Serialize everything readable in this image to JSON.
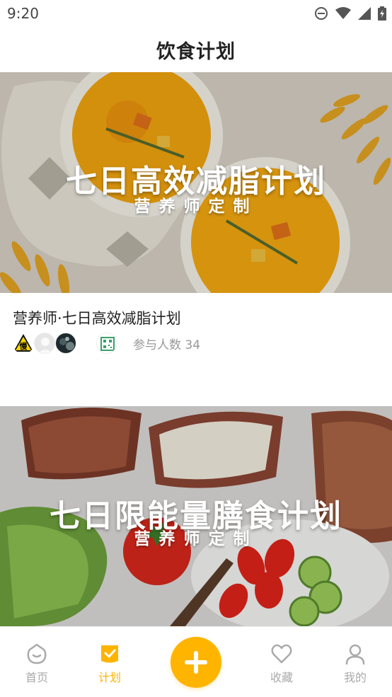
{
  "status_bar": {
    "time": "9:20",
    "icons": [
      "do-not-disturb-icon",
      "wifi-icon",
      "signal-icon",
      "battery-icon"
    ]
  },
  "header": {
    "title": "饮食计划"
  },
  "plans": [
    {
      "banner_title": "七日高效减脂计划",
      "banner_subtitle": "营养师定制",
      "name": "营养师·七日高效减脂计划",
      "participants_label": "参与人数 34",
      "avatars": [
        "avatar-slow-sign",
        "avatar-default",
        "avatar-dark",
        "avatar-qr"
      ]
    },
    {
      "banner_title": "七日限能量膳食计划",
      "banner_subtitle": "营养师定制"
    }
  ],
  "bottom_nav": {
    "home_label": "首页",
    "plan_label": "计划",
    "favorites_label": "收藏",
    "mine_label": "我的"
  },
  "colors": {
    "accent": "#ffb400",
    "inactive": "#aaaaaa",
    "text": "#222222",
    "muted": "#999999"
  }
}
